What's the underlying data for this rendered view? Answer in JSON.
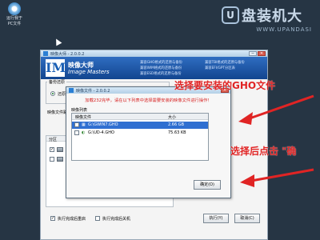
{
  "desktop": {
    "icon_label_line1": "运行我于",
    "icon_label_line2": "PC文件"
  },
  "brand": {
    "logo_letter": "U",
    "name": "盘装机大",
    "url": "WWW.UPANDASI"
  },
  "main_window": {
    "title": "映像大师 - 2.0.0.2",
    "min_label": "─",
    "close_label": "✕",
    "logo_cn": "映像大师",
    "logo_en": "Image Masters",
    "features": [
      "兼容GHO格式的还原与备份",
      "兼容WIM格式的还原与备份",
      "兼容ESD格式的还原与备份",
      "兼容TBI格式的还原与备份",
      "兼容EFI/GPT分区表"
    ],
    "mode_legend": "备份还原",
    "restore_label": "还原系统",
    "path_label": "映像文件路径",
    "partition_header": "分区",
    "drive_c": "C:",
    "drive_d": "D:",
    "opt_reboot": "执行完成后重启",
    "opt_shutdown": "执行完成后关机",
    "execute_btn": "执行(Y)",
    "cancel_btn": "取消(C)"
  },
  "dialog": {
    "title": "映像文件 - 2.0.0.2",
    "close_label": "✕",
    "notice": "加载232完毕，请在以下列表中选择需要安装的映像文件进行操作！",
    "list_label": "映像列表",
    "col_file": "映像文件",
    "col_size": "大小",
    "files": [
      {
        "name": "G:\\GWIN7.GHO",
        "size": "2.66 GB"
      },
      {
        "name": "G:\\UD-4.GHO",
        "size": "75.63 KB"
      }
    ],
    "ok_btn": "确定(O)"
  },
  "annotations": {
    "select_hint": "选择要安装的GHO文件",
    "confirm_hint": "选择后点击 \"确"
  },
  "colors": {
    "desktop_bg": "#263544",
    "banner": "#1a5fb4",
    "selection": "#2f6fd1",
    "annotation_red": "#e02424"
  }
}
